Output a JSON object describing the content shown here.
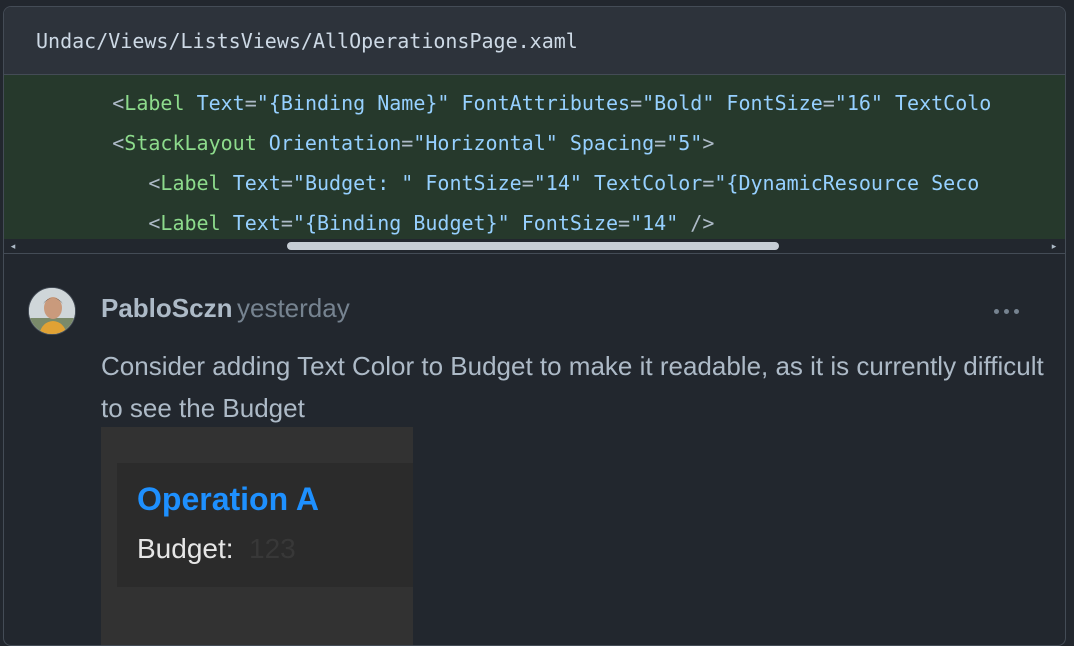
{
  "file": {
    "path": "Undac/Views/ListsViews/AllOperationsPage.xaml"
  },
  "code": {
    "lines": [
      {
        "indent": "      ",
        "tag": "Label",
        "attrs": [
          {
            "name": "Text",
            "value": "\"{Binding Name}\""
          },
          {
            "name": "FontAttributes",
            "value": "\"Bold\""
          },
          {
            "name": "FontSize",
            "value": "\"16\""
          },
          {
            "name": "TextColo",
            "value": ""
          }
        ],
        "close": ""
      },
      {
        "indent": "      ",
        "tag": "StackLayout",
        "attrs": [
          {
            "name": "Orientation",
            "value": "\"Horizontal\""
          },
          {
            "name": "Spacing",
            "value": "\"5\""
          }
        ],
        "close": ">"
      },
      {
        "indent": "         ",
        "tag": "Label",
        "attrs": [
          {
            "name": "Text",
            "value": "\"Budget: \""
          },
          {
            "name": "FontSize",
            "value": "\"14\""
          },
          {
            "name": "TextColor",
            "value": "\"{DynamicResource Seco"
          }
        ],
        "close": ""
      },
      {
        "indent": "         ",
        "tag": "Label",
        "attrs": [
          {
            "name": "Text",
            "value": "\"{Binding Budget}\""
          },
          {
            "name": "FontSize",
            "value": "\"14\""
          }
        ],
        "close": " />"
      }
    ]
  },
  "scrollbar": {
    "left_arrow": "◂",
    "right_arrow": "▸"
  },
  "comment": {
    "author": "PabloSczn",
    "timestamp": "yesterday",
    "body": "Consider adding Text Color to Budget to make it readable, as it is currently difficult to see the Budget",
    "more_icon": "kebab-horizontal-icon"
  },
  "attachment": {
    "title": "Operation A",
    "budget_label": "Budget:",
    "budget_value": "123",
    "title_color": "#1e90ff"
  }
}
